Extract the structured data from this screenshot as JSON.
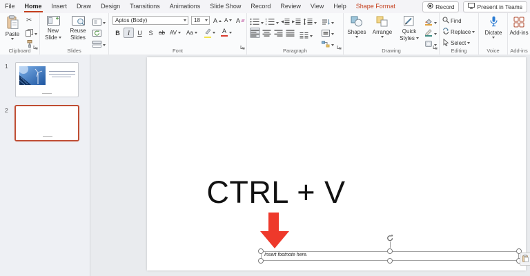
{
  "colors": {
    "accent": "#c43e1c",
    "arrow_red": "#ee392b",
    "selected_slide_border": "#bf4d33",
    "dictate_blue": "#2b7cd3"
  },
  "titlebar": {
    "tabs": [
      {
        "label": "File"
      },
      {
        "label": "Home",
        "active": true
      },
      {
        "label": "Insert"
      },
      {
        "label": "Draw"
      },
      {
        "label": "Design"
      },
      {
        "label": "Transitions"
      },
      {
        "label": "Animations"
      },
      {
        "label": "Slide Show"
      },
      {
        "label": "Record"
      },
      {
        "label": "Review"
      },
      {
        "label": "View"
      },
      {
        "label": "Help"
      },
      {
        "label": "Shape Format",
        "contextual": true
      }
    ],
    "record_button": "Record",
    "present_button": "Present in Teams"
  },
  "ribbon": {
    "clipboard": {
      "label": "Clipboard",
      "paste": "Paste"
    },
    "slides": {
      "label": "Slides",
      "new_line1": "New",
      "new_line2": "Slide",
      "reuse_line1": "Reuse",
      "reuse_line2": "Slides"
    },
    "font": {
      "label": "Font",
      "name": "Aptos (Body)",
      "size": "18",
      "bold": "B",
      "italic": "I",
      "underline": "U",
      "shadow": "S",
      "strike": "ab",
      "spacing": "AV",
      "case": "Aa",
      "grow": "A",
      "shrink": "A",
      "clear": "A",
      "color": "A"
    },
    "paragraph": {
      "label": "Paragraph"
    },
    "drawing": {
      "label": "Drawing",
      "shapes": "Shapes",
      "arrange": "Arrange",
      "quick_line1": "Quick",
      "quick_line2": "Styles"
    },
    "editing": {
      "label": "Editing",
      "find": "Find",
      "replace": "Replace",
      "select": "Select"
    },
    "voice": {
      "label": "Voice",
      "dictate": "Dictate"
    },
    "addins": {
      "label": "Add-ins",
      "button": "Add-ins"
    }
  },
  "slide_panel": {
    "slide1_number": "1",
    "slide2_number": "2"
  },
  "canvas": {
    "main_text": "CTRL + V",
    "footnote_placeholder": "Insert footnote here."
  }
}
